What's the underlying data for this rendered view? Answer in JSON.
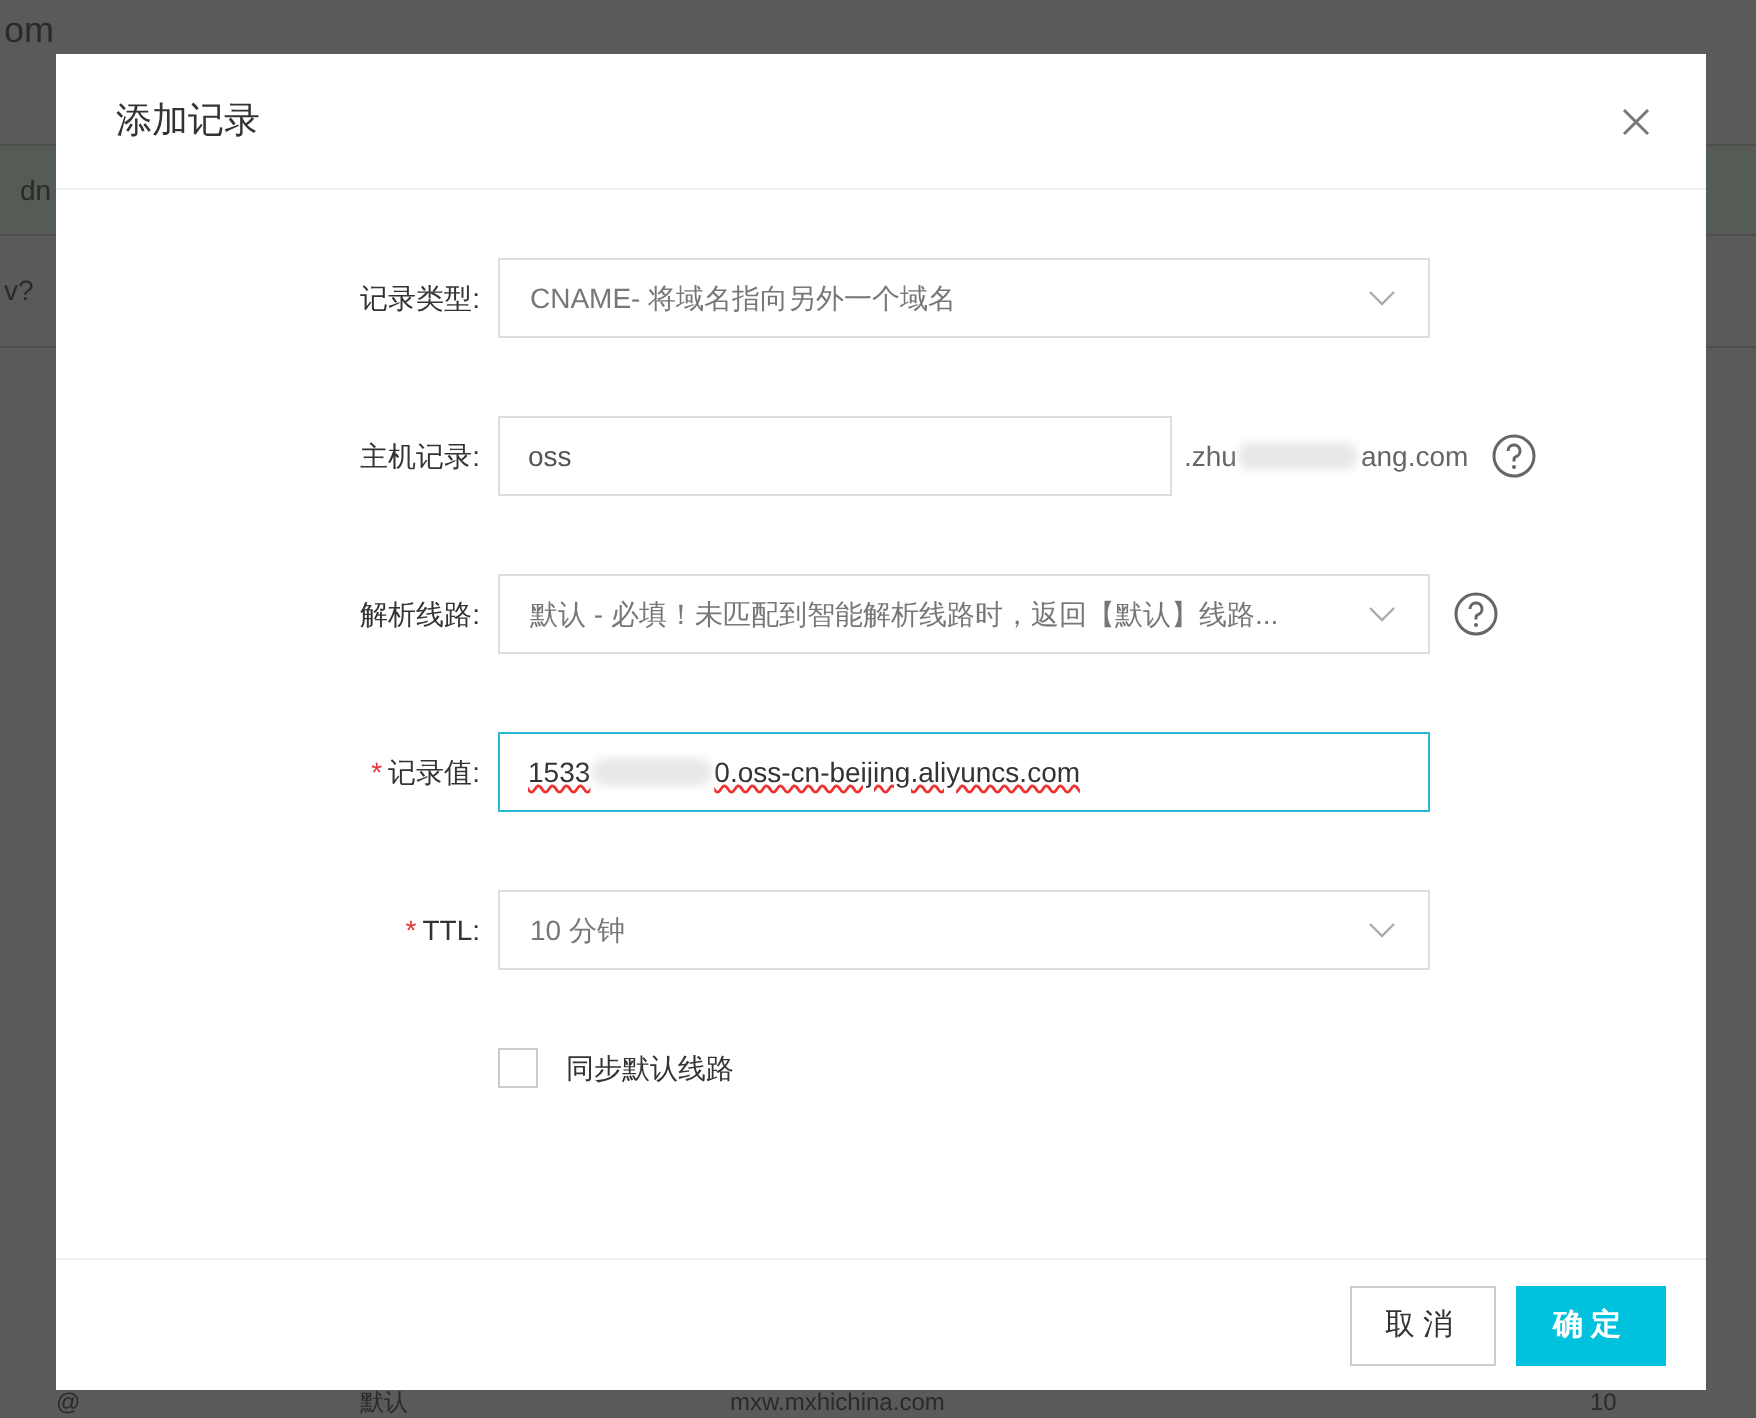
{
  "background": {
    "title_fragment": "om",
    "row_fragments": [
      "dn",
      "v?"
    ],
    "bottom_row": [
      "@",
      "默认",
      "mxw.mxhichina.com",
      "10"
    ]
  },
  "dialog": {
    "title": "添加记录",
    "fields": [
      {
        "kind": "select",
        "label": "记录类型:",
        "value": "CNAME- 将域名指向另外一个域名",
        "help": false,
        "focused": false
      },
      {
        "kind": "input",
        "label": "主机记录:",
        "value": "oss",
        "suffix_start": ".zhu",
        "suffix_end": "ang.com",
        "help": true,
        "focused": false
      },
      {
        "kind": "select",
        "label": "解析线路:",
        "value": "默认 - 必填！未匹配到智能解析线路时，返回【默认】线路...",
        "help": true,
        "focused": false
      },
      {
        "kind": "redacted_input",
        "label": "记录值:",
        "required_mark": "*",
        "value_start": "1533",
        "value_end": "0.oss-cn-beijing.aliyuncs.com",
        "help": false,
        "focused": true
      },
      {
        "kind": "select",
        "label": "TTL:",
        "required_mark": "*",
        "value": "10 分钟",
        "help": false,
        "focused": false
      }
    ],
    "sync_option": {
      "label": "同步默认线路",
      "checked": false
    },
    "buttons": [
      {
        "label": "取消",
        "primary": false
      },
      {
        "label": "确定",
        "primary": true
      }
    ]
  }
}
